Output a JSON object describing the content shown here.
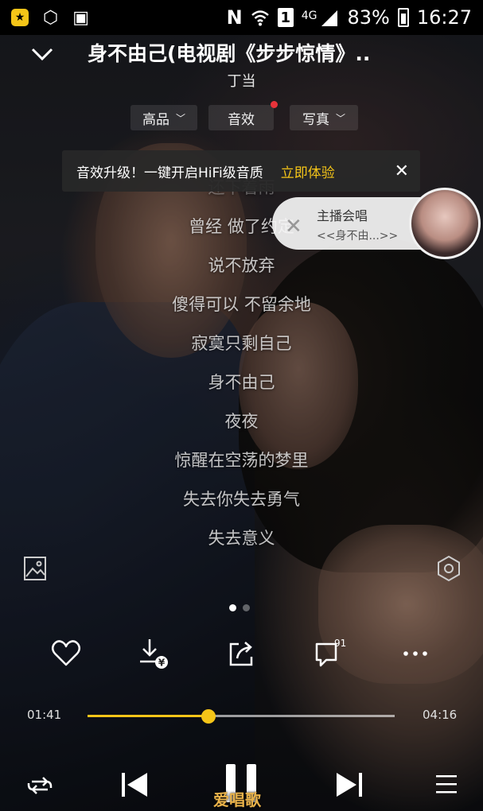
{
  "status_bar": {
    "carrier_icon": "notification-app-icon",
    "battery_percent": "83%",
    "time": "16:27",
    "network": "4G",
    "sim_badge": "1",
    "nfc_label": "N"
  },
  "header": {
    "title": "身不由己(电视剧《步步惊情》..",
    "artist": "丁当"
  },
  "tabs": {
    "quality": "高品",
    "effect": "音效",
    "photo": "写真"
  },
  "banner": {
    "text": "音效升级！一键开启HiFi级音质",
    "cta": "立即体验",
    "close": "✕"
  },
  "lyrics": [
    "还下着雨",
    "曾经 做了约定",
    "说不放弃",
    "傻得可以 不留余地",
    "寂寞只剩自己",
    "身不由己",
    "夜夜",
    "惊醒在空荡的梦里",
    "失去你失去勇气",
    "失去意义"
  ],
  "cosing": {
    "title": "主播会唱",
    "subtitle": "<<身不由...>>"
  },
  "pager": {
    "count": 2,
    "active": 0
  },
  "actions": {
    "comment_count": "91"
  },
  "progress": {
    "current": "01:41",
    "total": "04:16",
    "fraction": 0.395
  },
  "watermark": "爱唱歌",
  "colors": {
    "accent": "#f5c518",
    "red_dot": "#e8333a"
  }
}
